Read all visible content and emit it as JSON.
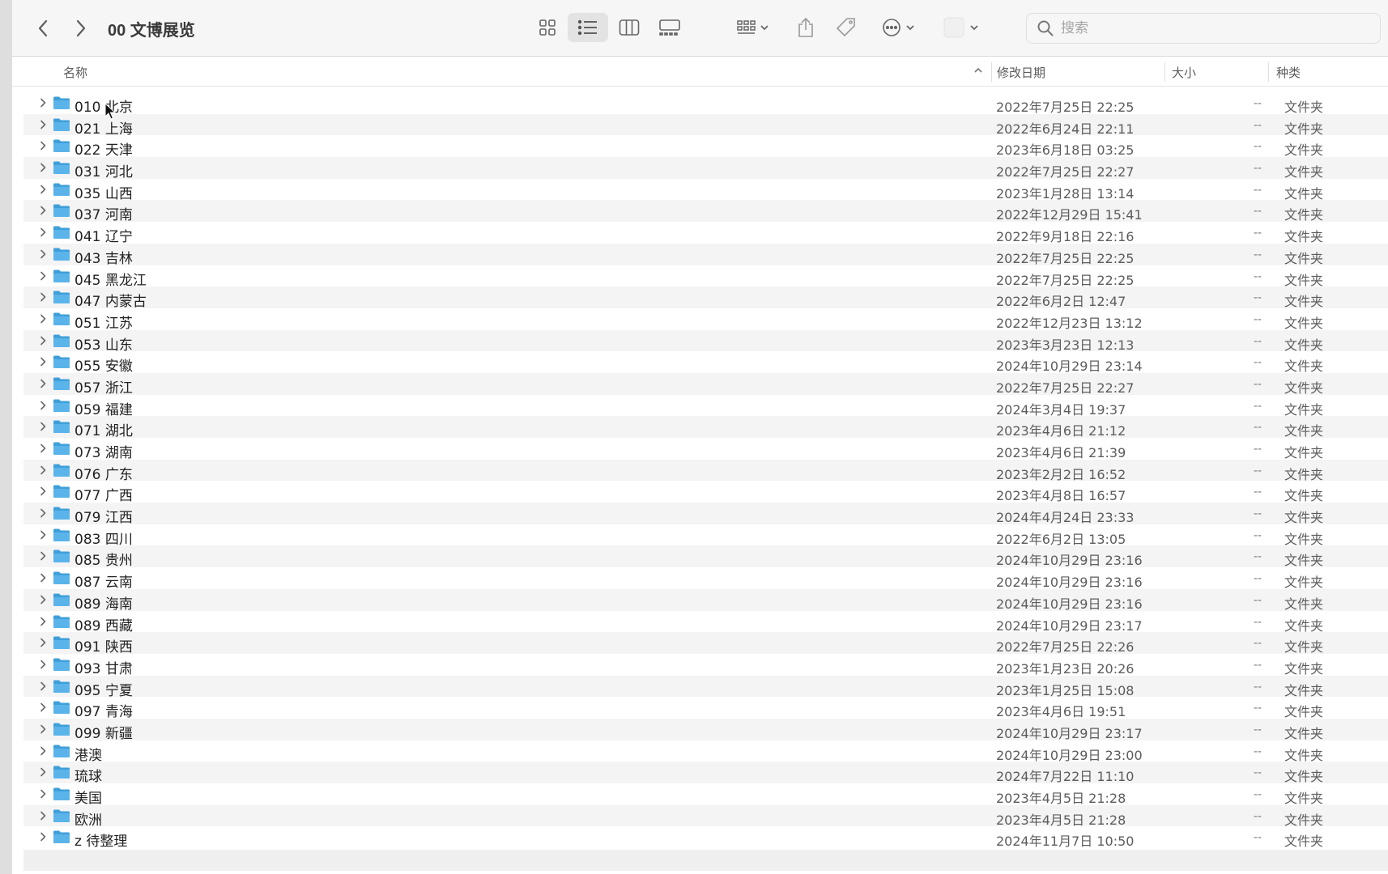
{
  "window": {
    "title": "00 文博展览"
  },
  "toolbar": {
    "back_icon": "chevron-left-icon",
    "forward_icon": "chevron-right-icon",
    "views": [
      "icon-view",
      "list-view",
      "column-view",
      "gallery-view"
    ],
    "active_view": "list-view"
  },
  "search": {
    "placeholder": "搜索",
    "value": ""
  },
  "columns": {
    "name": "名称",
    "date": "修改日期",
    "size": "大小",
    "kind": "种类",
    "sort": "ascending"
  },
  "colors": {
    "folder": "#5ab4ea",
    "folder_dark": "#3f9fd9",
    "row_alt": "#f4f4f5"
  },
  "rows": [
    {
      "name": "010 北京",
      "date": "2022年7月25日 22:25",
      "size": "--",
      "kind": "文件夹"
    },
    {
      "name": "021 上海",
      "date": "2022年6月24日 22:11",
      "size": "--",
      "kind": "文件夹"
    },
    {
      "name": "022 天津",
      "date": "2023年6月18日 03:25",
      "size": "--",
      "kind": "文件夹"
    },
    {
      "name": "031 河北",
      "date": "2022年7月25日 22:27",
      "size": "--",
      "kind": "文件夹"
    },
    {
      "name": "035 山西",
      "date": "2023年1月28日 13:14",
      "size": "--",
      "kind": "文件夹"
    },
    {
      "name": "037 河南",
      "date": "2022年12月29日 15:41",
      "size": "--",
      "kind": "文件夹"
    },
    {
      "name": "041 辽宁",
      "date": "2022年9月18日 22:16",
      "size": "--",
      "kind": "文件夹"
    },
    {
      "name": "043 吉林",
      "date": "2022年7月25日 22:25",
      "size": "--",
      "kind": "文件夹"
    },
    {
      "name": "045 黑龙江",
      "date": "2022年7月25日 22:25",
      "size": "--",
      "kind": "文件夹"
    },
    {
      "name": "047 内蒙古",
      "date": "2022年6月2日 12:47",
      "size": "--",
      "kind": "文件夹"
    },
    {
      "name": "051 江苏",
      "date": "2022年12月23日 13:12",
      "size": "--",
      "kind": "文件夹"
    },
    {
      "name": "053 山东",
      "date": "2023年3月23日 12:13",
      "size": "--",
      "kind": "文件夹"
    },
    {
      "name": "055 安徽",
      "date": "2024年10月29日 23:14",
      "size": "--",
      "kind": "文件夹"
    },
    {
      "name": "057 浙江",
      "date": "2022年7月25日 22:27",
      "size": "--",
      "kind": "文件夹"
    },
    {
      "name": "059 福建",
      "date": "2024年3月4日 19:37",
      "size": "--",
      "kind": "文件夹"
    },
    {
      "name": "071 湖北",
      "date": "2023年4月6日 21:12",
      "size": "--",
      "kind": "文件夹"
    },
    {
      "name": "073 湖南",
      "date": "2023年4月6日 21:39",
      "size": "--",
      "kind": "文件夹"
    },
    {
      "name": "076 广东",
      "date": "2023年2月2日 16:52",
      "size": "--",
      "kind": "文件夹"
    },
    {
      "name": "077 广西",
      "date": "2023年4月8日 16:57",
      "size": "--",
      "kind": "文件夹"
    },
    {
      "name": "079 江西",
      "date": "2024年4月24日 23:33",
      "size": "--",
      "kind": "文件夹"
    },
    {
      "name": "083 四川",
      "date": "2022年6月2日 13:05",
      "size": "--",
      "kind": "文件夹"
    },
    {
      "name": "085 贵州",
      "date": "2024年10月29日 23:16",
      "size": "--",
      "kind": "文件夹"
    },
    {
      "name": "087 云南",
      "date": "2024年10月29日 23:16",
      "size": "--",
      "kind": "文件夹"
    },
    {
      "name": "089 海南",
      "date": "2024年10月29日 23:16",
      "size": "--",
      "kind": "文件夹"
    },
    {
      "name": "089 西藏",
      "date": "2024年10月29日 23:17",
      "size": "--",
      "kind": "文件夹"
    },
    {
      "name": "091 陕西",
      "date": "2022年7月25日 22:26",
      "size": "--",
      "kind": "文件夹"
    },
    {
      "name": "093 甘肃",
      "date": "2023年1月23日 20:26",
      "size": "--",
      "kind": "文件夹"
    },
    {
      "name": "095 宁夏",
      "date": "2023年1月25日 15:08",
      "size": "--",
      "kind": "文件夹"
    },
    {
      "name": "097 青海",
      "date": "2023年4月6日 19:51",
      "size": "--",
      "kind": "文件夹"
    },
    {
      "name": "099 新疆",
      "date": "2024年10月29日 23:17",
      "size": "--",
      "kind": "文件夹"
    },
    {
      "name": "港澳",
      "date": "2024年10月29日 23:00",
      "size": "--",
      "kind": "文件夹"
    },
    {
      "name": "琉球",
      "date": "2024年7月22日 11:10",
      "size": "--",
      "kind": "文件夹"
    },
    {
      "name": "美国",
      "date": "2023年4月5日 21:28",
      "size": "--",
      "kind": "文件夹"
    },
    {
      "name": "欧洲",
      "date": "2023年4月5日 21:28",
      "size": "--",
      "kind": "文件夹"
    },
    {
      "name": "z 待整理",
      "date": "2024年11月7日 10:50",
      "size": "--",
      "kind": "文件夹"
    }
  ]
}
